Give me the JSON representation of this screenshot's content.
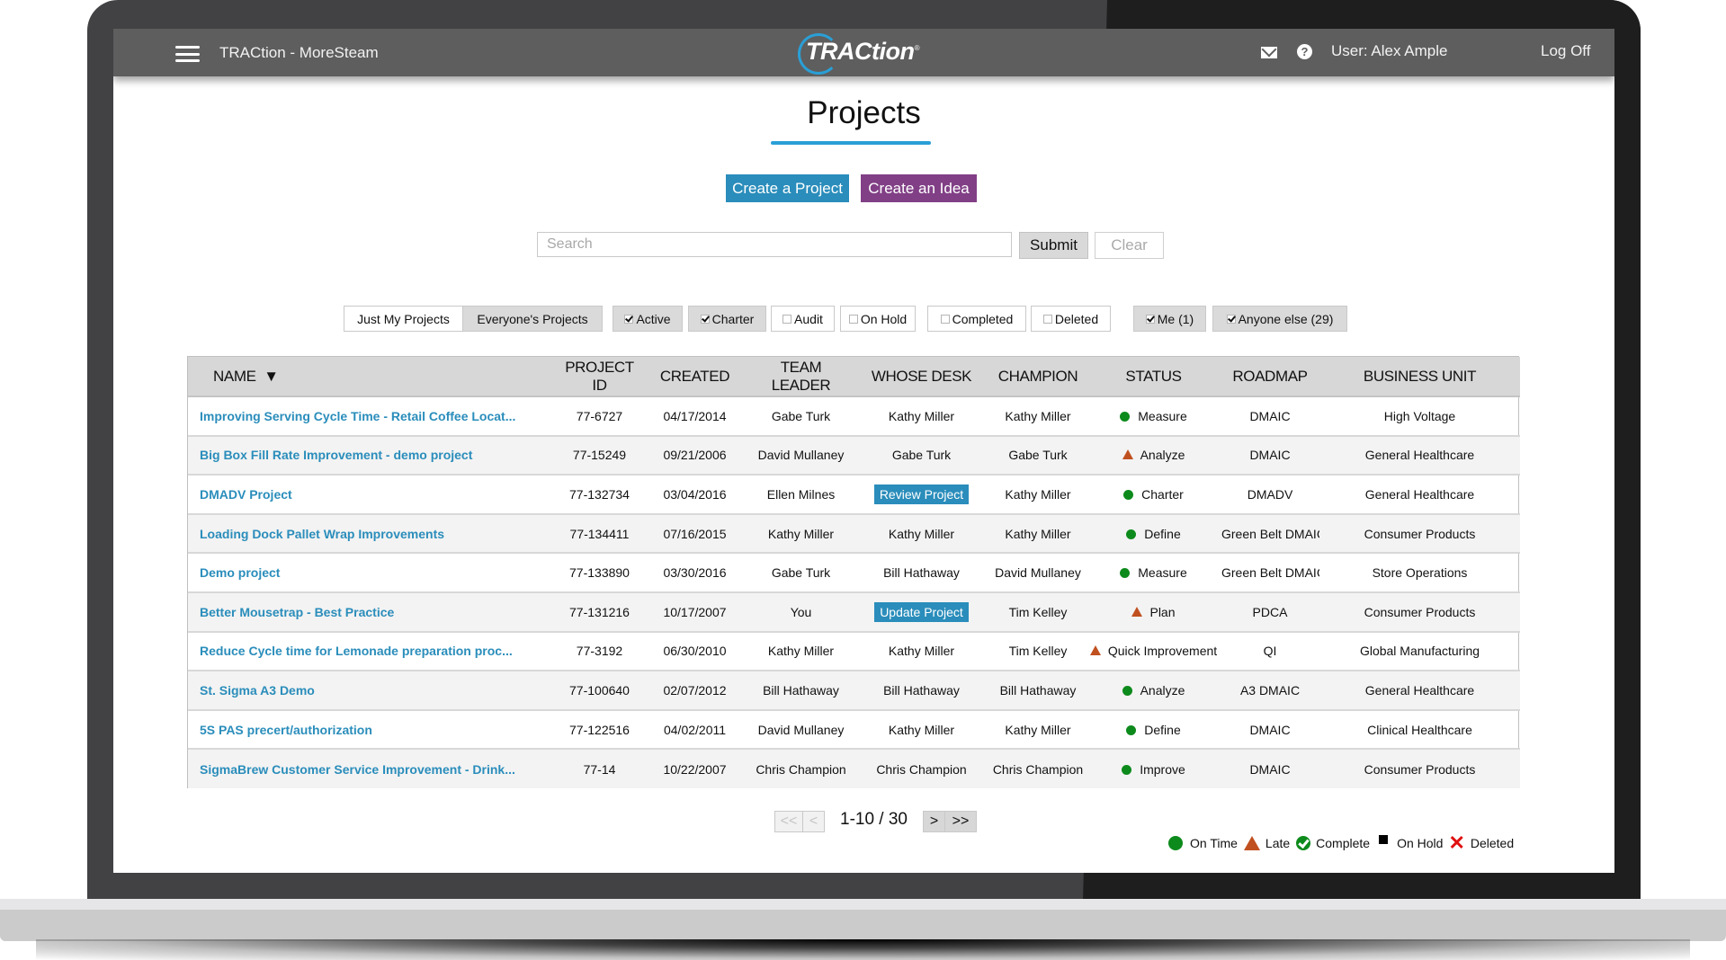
{
  "header": {
    "app_title": "TRACtion - MoreSteam",
    "logo_text": "TRACtion",
    "logo_reg": "®",
    "help_glyph": "?",
    "user_label": "User:  Alex Ample",
    "logoff_label": "Log Off",
    "icons": [
      "hamburger-menu-icon",
      "mail-icon",
      "help-icon"
    ]
  },
  "page": {
    "title": "Projects",
    "accent_color": "#2a9fd6"
  },
  "actions": {
    "create_project": "Create a Project",
    "create_idea": "Create an Idea",
    "create_project_color": "#2a8dbb",
    "create_idea_color": "#813f86"
  },
  "search": {
    "value": "",
    "placeholder": "Search",
    "submit_label": "Submit",
    "clear_label": "Clear"
  },
  "filters": {
    "scope": [
      {
        "label": "Just My Projects",
        "selected": false
      },
      {
        "label": "Everyone's Projects",
        "selected": true
      }
    ],
    "states": [
      {
        "label": "Active",
        "checked": true
      },
      {
        "label": "Charter",
        "checked": true
      },
      {
        "label": "Audit",
        "checked": false
      },
      {
        "label": "On Hold",
        "checked": false
      },
      {
        "label": "Completed",
        "checked": false
      },
      {
        "label": "Deleted",
        "checked": false
      }
    ],
    "owners": [
      {
        "label": "Me (1)",
        "checked": true
      },
      {
        "label": "Anyone else (29)",
        "checked": true
      }
    ]
  },
  "table": {
    "sort_indicator": "▼",
    "columns": [
      "NAME",
      "PROJECT ID",
      "CREATED",
      "TEAM LEADER",
      "WHOSE DESK",
      "CHAMPION",
      "STATUS",
      "ROADMAP",
      "BUSINESS UNIT"
    ],
    "rows": [
      {
        "name": "Improving Serving Cycle Time - Retail Coffee Locat...",
        "id": "77-6727",
        "created": "04/17/2014",
        "leader": "Gabe Turk",
        "desk": "Kathy Miller",
        "desk_is_button": false,
        "champion": "Kathy Miller",
        "status_icon": "on-time",
        "status": "Measure",
        "roadmap": "DMAIC",
        "unit": "High Voltage"
      },
      {
        "name": "Big Box Fill Rate Improvement - demo project",
        "id": "77-15249",
        "created": "09/21/2006",
        "leader": "David Mullaney",
        "desk": "Gabe Turk",
        "desk_is_button": false,
        "champion": "Gabe Turk",
        "status_icon": "late",
        "status": "Analyze",
        "roadmap": "DMAIC",
        "unit": "General Healthcare"
      },
      {
        "name": "DMADV Project",
        "id": "77-132734",
        "created": "03/04/2016",
        "leader": "Ellen Milnes",
        "desk": "Review Project",
        "desk_is_button": true,
        "champion": "Kathy Miller",
        "status_icon": "on-time",
        "status": "Charter",
        "roadmap": "DMADV",
        "unit": "General Healthcare"
      },
      {
        "name": "Loading Dock Pallet Wrap Improvements",
        "id": "77-134411",
        "created": "07/16/2015",
        "leader": "Kathy Miller",
        "desk": "Kathy Miller",
        "desk_is_button": false,
        "champion": "Kathy Miller",
        "status_icon": "on-time",
        "status": "Define",
        "roadmap": "Green Belt DMAIC",
        "unit": "Consumer Products"
      },
      {
        "name": "Demo project",
        "id": "77-133890",
        "created": "03/30/2016",
        "leader": "Gabe Turk",
        "desk": "Bill Hathaway",
        "desk_is_button": false,
        "champion": "David Mullaney",
        "status_icon": "on-time",
        "status": "Measure",
        "roadmap": "Green Belt DMAIC",
        "unit": "Store Operations"
      },
      {
        "name": "Better Mousetrap - Best Practice",
        "id": "77-131216",
        "created": "10/17/2007",
        "leader": "You",
        "desk": "Update Project",
        "desk_is_button": true,
        "champion": "Tim Kelley",
        "status_icon": "late",
        "status": "Plan",
        "roadmap": "PDCA",
        "unit": "Consumer Products"
      },
      {
        "name": "Reduce Cycle time for Lemonade preparation proc...",
        "id": "77-3192",
        "created": "06/30/2010",
        "leader": "Kathy Miller",
        "desk": "Kathy Miller",
        "desk_is_button": false,
        "champion": "Tim Kelley",
        "status_icon": "late",
        "status": "Quick Improvement",
        "roadmap": "QI",
        "unit": "Global Manufacturing"
      },
      {
        "name": "St. Sigma A3 Demo",
        "id": "77-100640",
        "created": "02/07/2012",
        "leader": "Bill Hathaway",
        "desk": "Bill Hathaway",
        "desk_is_button": false,
        "champion": "Bill Hathaway",
        "status_icon": "on-time",
        "status": "Analyze",
        "roadmap": "A3 DMAIC",
        "unit": "General Healthcare"
      },
      {
        "name": "5S PAS precert/authorization",
        "id": "77-122516",
        "created": "04/02/2011",
        "leader": "David Mullaney",
        "desk": "Kathy Miller",
        "desk_is_button": false,
        "champion": "Kathy Miller",
        "status_icon": "on-time",
        "status": "Define",
        "roadmap": "DMAIC",
        "unit": "Clinical Healthcare"
      },
      {
        "name": "SigmaBrew Customer Service Improvement - Drink...",
        "id": "77-14",
        "created": "10/22/2007",
        "leader": "Chris Champion",
        "desk": "Chris Champion",
        "desk_is_button": false,
        "champion": "Chris Champion",
        "status_icon": "on-time",
        "status": "Improve",
        "roadmap": "DMAIC",
        "unit": "Consumer Products"
      }
    ]
  },
  "pagination": {
    "first": "<<",
    "prev": "<",
    "count": "1-10 / 30",
    "next": ">",
    "last": ">>",
    "first_enabled": false,
    "prev_enabled": false,
    "next_enabled": true,
    "last_enabled": true
  },
  "legend": {
    "on_time": "On Time",
    "late": "Late",
    "complete": "Complete",
    "on_hold": "On Hold",
    "deleted": "Deleted",
    "deleted_glyph": "✕",
    "colors": {
      "on_time": "#0d8a1c",
      "late": "#c0501f",
      "complete": "#0d8a1c",
      "on_hold": "#000000",
      "deleted": "#e01010"
    }
  }
}
